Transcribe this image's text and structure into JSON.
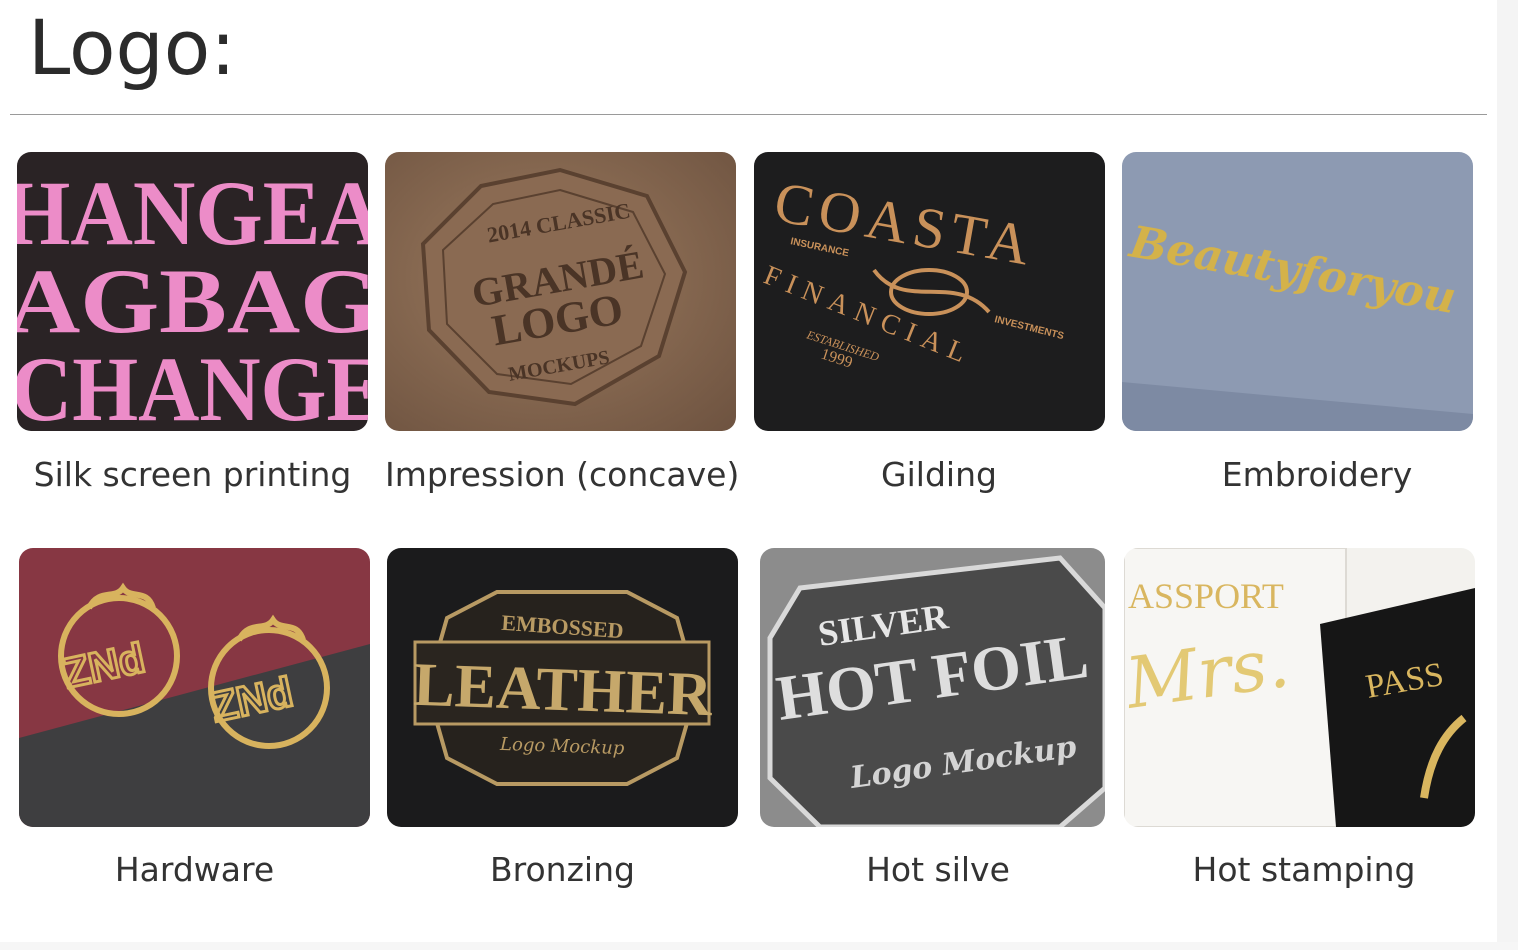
{
  "heading": "Logo:",
  "items": [
    {
      "label": "Silk screen printing"
    },
    {
      "label": "Impression (concave)"
    },
    {
      "label": "Gilding"
    },
    {
      "label": "Embroidery"
    },
    {
      "label": "Hardware"
    },
    {
      "label": "Bronzing"
    },
    {
      "label": "Hot silve"
    },
    {
      "label": "Hot stamping"
    }
  ],
  "tile_text": {
    "silk": [
      "HANGEA",
      "AGBAG",
      "CHANGE"
    ],
    "impression": {
      "ring": "2014 CLASSIC",
      "line1": "GRANDÉ",
      "line2": "LOGO",
      "line3": "MOCKUPS"
    },
    "gilding": {
      "top": "COASTA",
      "left": "INSURANCE",
      "right": "INVESTMENTS",
      "arc": "FINANCIAL",
      "est": "ESTABLISHED",
      "year": "1999"
    },
    "embroidery": "Beautyforyou",
    "hardware": "ZNd",
    "bronzing": {
      "top": "EMBOSSED",
      "main": "LEATHER",
      "sub": "Logo Mockup"
    },
    "silver": {
      "top": "SILVER",
      "main": "HOT FOIL",
      "sub": "Logo Mockup"
    },
    "stamping": {
      "passport_a": "ASSPORT",
      "mrs": "Mrs.",
      "passport_b": "PASS"
    }
  }
}
